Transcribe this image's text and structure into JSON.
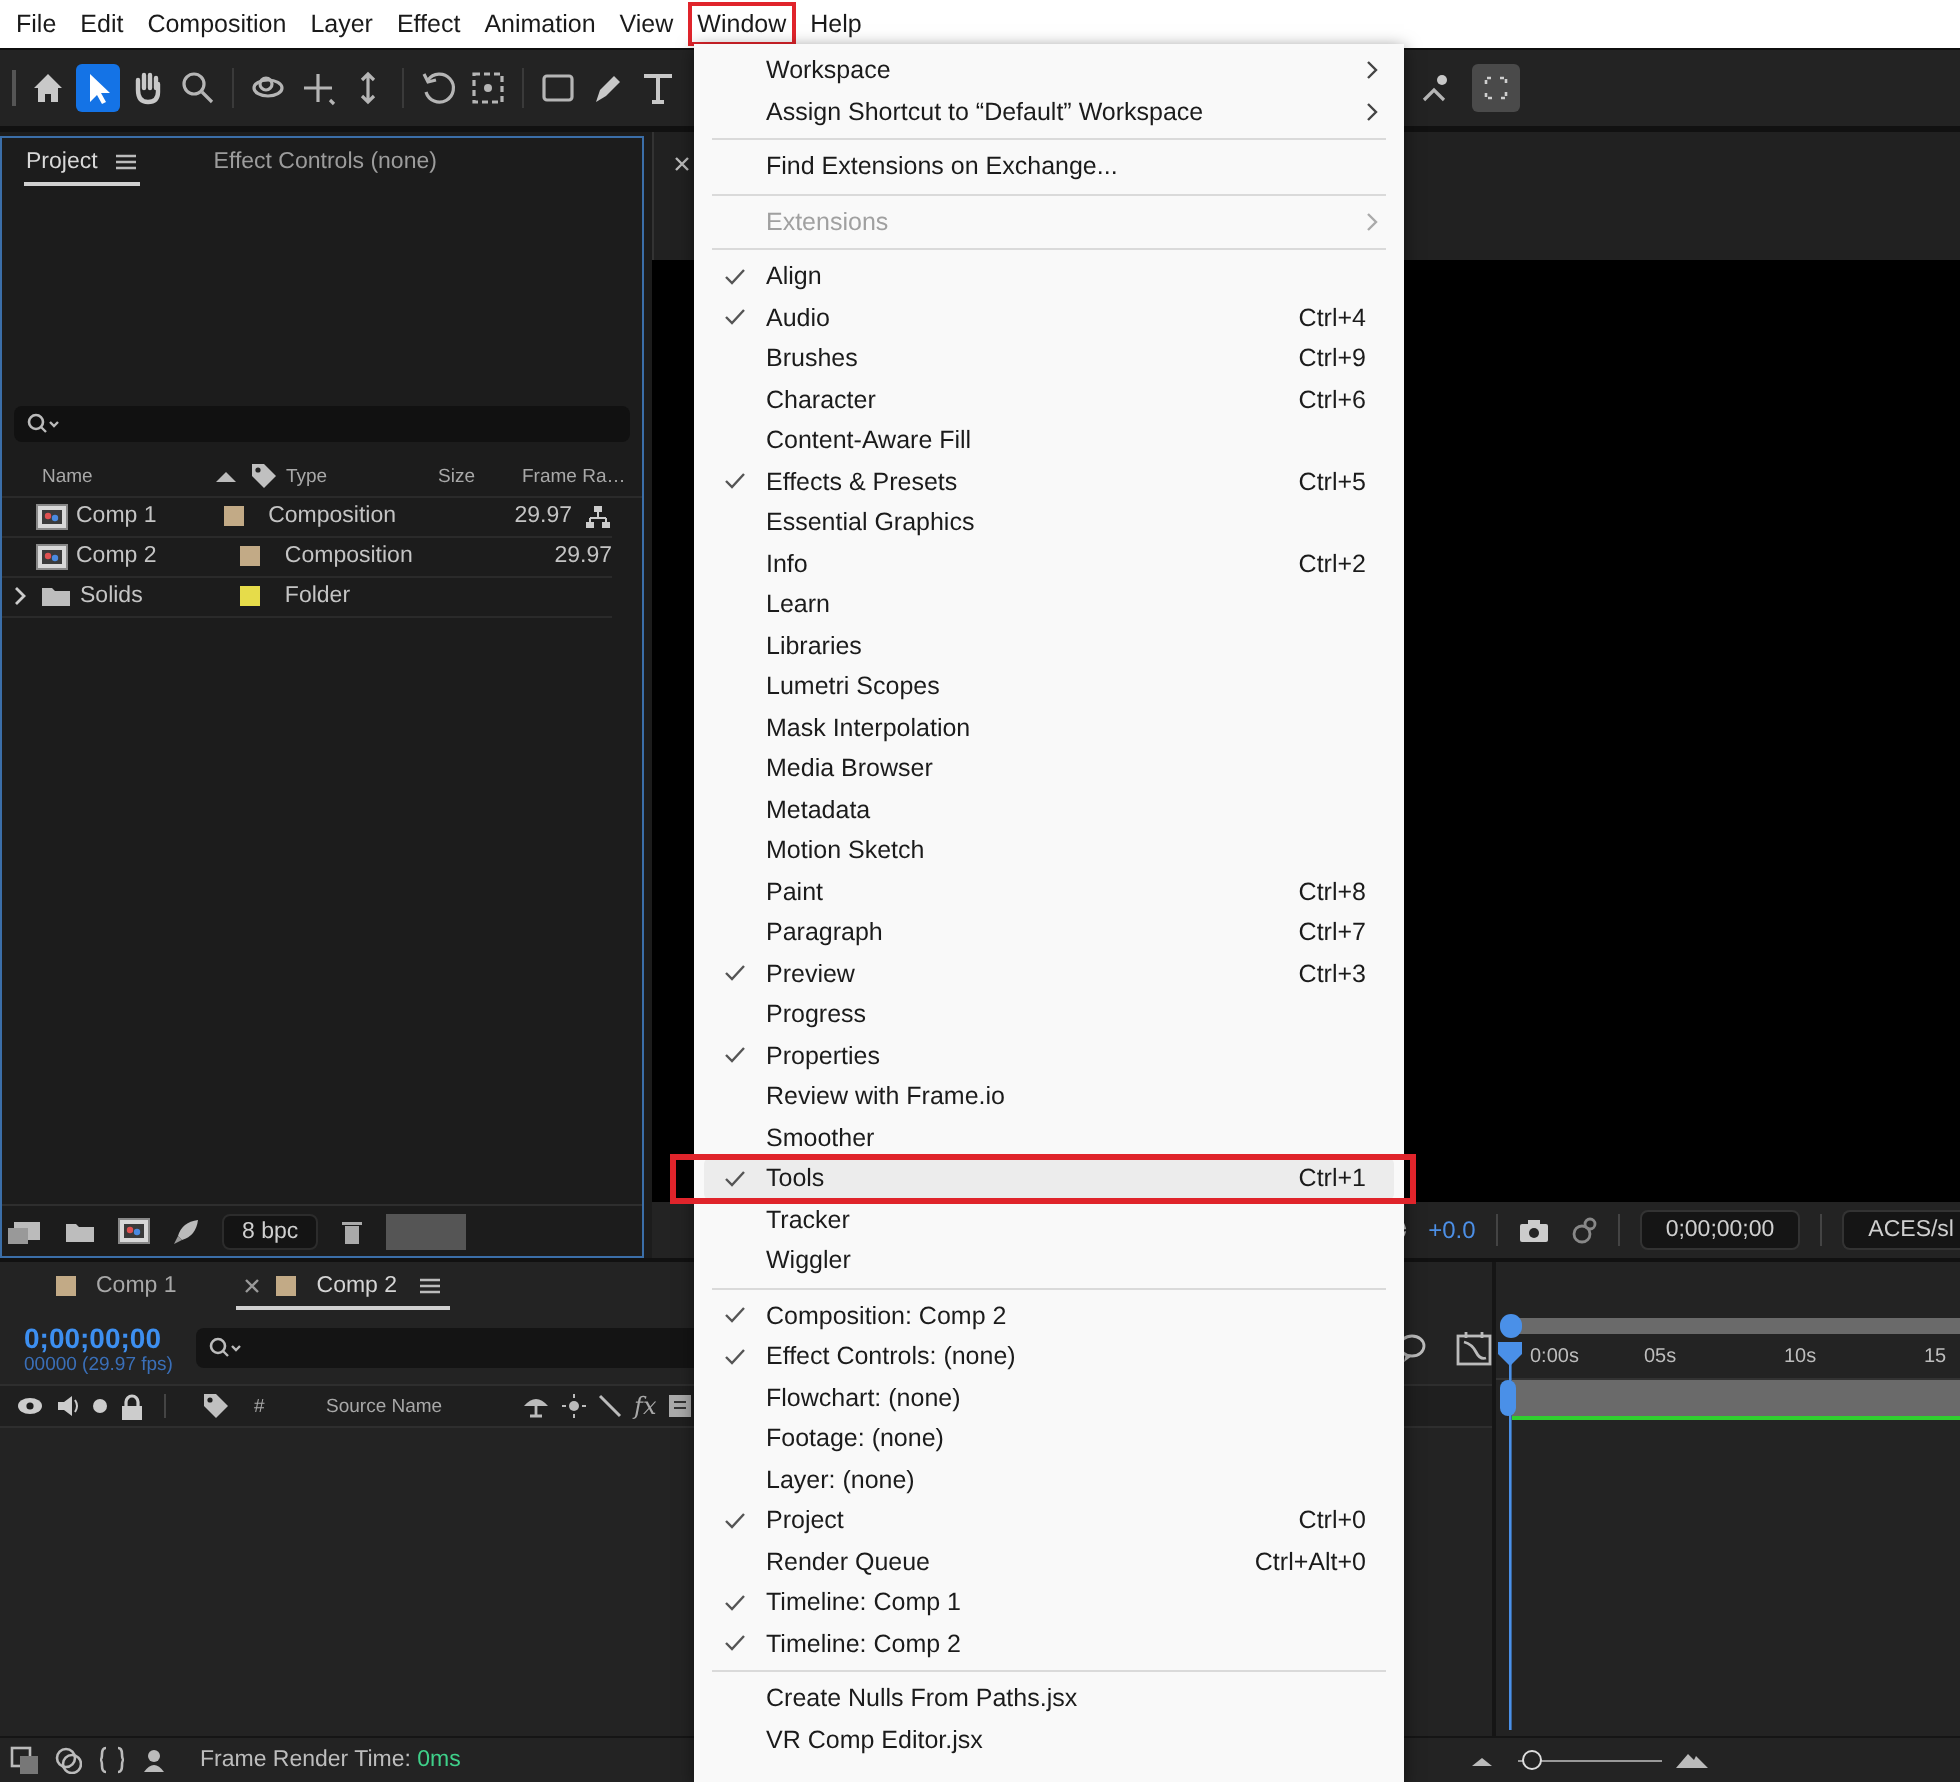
{
  "menubar": [
    {
      "label": "File",
      "selected": false
    },
    {
      "label": "Edit",
      "selected": false
    },
    {
      "label": "Composition",
      "selected": false
    },
    {
      "label": "Layer",
      "selected": false
    },
    {
      "label": "Effect",
      "selected": false
    },
    {
      "label": "Animation",
      "selected": false
    },
    {
      "label": "View",
      "selected": false
    },
    {
      "label": "Window",
      "selected": true
    },
    {
      "label": "Help",
      "selected": false
    }
  ],
  "toolbar": [
    {
      "kind": "home",
      "selected": false
    },
    {
      "kind": "selection",
      "selected": true
    },
    {
      "kind": "hand",
      "selected": false
    },
    {
      "kind": "zoom",
      "selected": false
    },
    {
      "kind": "orbit",
      "selected": false
    },
    {
      "kind": "pan",
      "selected": false
    },
    {
      "kind": "dolly",
      "selected": false
    },
    {
      "kind": "rotate",
      "selected": false
    },
    {
      "kind": "anchor",
      "selected": false
    },
    {
      "kind": "rectangle",
      "selected": false
    },
    {
      "kind": "pen",
      "selected": false
    },
    {
      "kind": "type",
      "selected": false
    }
  ],
  "project_panel": {
    "tabs": [
      {
        "label": "Project",
        "selected": true
      },
      {
        "label": "Effect Controls (none)",
        "selected": false
      }
    ],
    "columns": [
      "Name",
      "Type",
      "Size",
      "Frame Ra…"
    ],
    "rows": [
      {
        "name": "Comp 1",
        "kind": "composition",
        "color": "#c2aa86",
        "type": "Composition",
        "frame_rate": "29.97"
      },
      {
        "name": "Comp 2",
        "kind": "composition",
        "color": "#c2aa86",
        "type": "Composition",
        "frame_rate": "29.97"
      },
      {
        "name": "Solids",
        "kind": "folder",
        "color": "#e6dc4a",
        "type": "Folder"
      }
    ],
    "bit_depth": "8 bpc"
  },
  "viewer": {
    "exposure": "+0.0",
    "timecode": "0;00;00;00",
    "color_space": "ACES/sl"
  },
  "timeline": {
    "tabs": [
      {
        "label": "Comp 1",
        "color": "#c2aa86",
        "selected": false
      },
      {
        "label": "Comp 2",
        "color": "#c2aa86",
        "selected": true
      }
    ],
    "timecode": "0;00;00;00",
    "frame_info": "00000 (29.97 fps)",
    "columns": [
      "#",
      "Source Name",
      "fx"
    ],
    "ruler": [
      "0:00s",
      "05s",
      "10s",
      "15"
    ],
    "zoom": {
      "level": 0.02
    }
  },
  "status_bar": {
    "label": "Frame Render Time:",
    "value": "0ms"
  },
  "window_menu": {
    "sections": [
      [
        {
          "label": "Workspace",
          "kind": "submenu",
          "checked": false,
          "disabled": false,
          "selected": false
        },
        {
          "label": "Assign Shortcut to “Default” Workspace",
          "kind": "submenu",
          "checked": false,
          "disabled": false,
          "selected": false
        }
      ],
      [
        {
          "label": "Find Extensions on Exchange...",
          "kind": "item",
          "checked": false,
          "disabled": false,
          "selected": false
        }
      ],
      [
        {
          "label": "Extensions",
          "kind": "submenu",
          "checked": false,
          "disabled": true,
          "selected": false
        }
      ],
      [
        {
          "label": "Align",
          "kind": "item",
          "checked": true,
          "disabled": false,
          "selected": false
        },
        {
          "label": "Audio",
          "kind": "item",
          "checked": true,
          "disabled": false,
          "selected": false,
          "shortcut": "Ctrl+4"
        },
        {
          "label": "Brushes",
          "kind": "item",
          "checked": false,
          "disabled": false,
          "selected": false,
          "shortcut": "Ctrl+9"
        },
        {
          "label": "Character",
          "kind": "item",
          "checked": false,
          "disabled": false,
          "selected": false,
          "shortcut": "Ctrl+6"
        },
        {
          "label": "Content-Aware Fill",
          "kind": "item",
          "checked": false,
          "disabled": false,
          "selected": false
        },
        {
          "label": "Effects & Presets",
          "kind": "item",
          "checked": true,
          "disabled": false,
          "selected": false,
          "shortcut": "Ctrl+5"
        },
        {
          "label": "Essential Graphics",
          "kind": "item",
          "checked": false,
          "disabled": false,
          "selected": false
        },
        {
          "label": "Info",
          "kind": "item",
          "checked": false,
          "disabled": false,
          "selected": false,
          "shortcut": "Ctrl+2"
        },
        {
          "label": "Learn",
          "kind": "item",
          "checked": false,
          "disabled": false,
          "selected": false
        },
        {
          "label": "Libraries",
          "kind": "item",
          "checked": false,
          "disabled": false,
          "selected": false
        },
        {
          "label": "Lumetri Scopes",
          "kind": "item",
          "checked": false,
          "disabled": false,
          "selected": false
        },
        {
          "label": "Mask Interpolation",
          "kind": "item",
          "checked": false,
          "disabled": false,
          "selected": false
        },
        {
          "label": "Media Browser",
          "kind": "item",
          "checked": false,
          "disabled": false,
          "selected": false
        },
        {
          "label": "Metadata",
          "kind": "item",
          "checked": false,
          "disabled": false,
          "selected": false
        },
        {
          "label": "Motion Sketch",
          "kind": "item",
          "checked": false,
          "disabled": false,
          "selected": false
        },
        {
          "label": "Paint",
          "kind": "item",
          "checked": false,
          "disabled": false,
          "selected": false,
          "shortcut": "Ctrl+8"
        },
        {
          "label": "Paragraph",
          "kind": "item",
          "checked": false,
          "disabled": false,
          "selected": false,
          "shortcut": "Ctrl+7"
        },
        {
          "label": "Preview",
          "kind": "item",
          "checked": true,
          "disabled": false,
          "selected": false,
          "shortcut": "Ctrl+3"
        },
        {
          "label": "Progress",
          "kind": "item",
          "checked": false,
          "disabled": false,
          "selected": false
        },
        {
          "label": "Properties",
          "kind": "item",
          "checked": true,
          "disabled": false,
          "selected": false
        },
        {
          "label": "Review with Frame.io",
          "kind": "item",
          "checked": false,
          "disabled": false,
          "selected": false
        },
        {
          "label": "Smoother",
          "kind": "item",
          "checked": false,
          "disabled": false,
          "selected": false
        },
        {
          "label": "Tools",
          "kind": "item",
          "checked": true,
          "disabled": false,
          "selected": true,
          "shortcut": "Ctrl+1"
        },
        {
          "label": "Tracker",
          "kind": "item",
          "checked": false,
          "disabled": false,
          "selected": false
        },
        {
          "label": "Wiggler",
          "kind": "item",
          "checked": false,
          "disabled": false,
          "selected": false
        }
      ],
      [
        {
          "label": "Composition: Comp 2",
          "kind": "item",
          "checked": true,
          "disabled": false,
          "selected": false
        },
        {
          "label": "Effect Controls: (none)",
          "kind": "item",
          "checked": true,
          "disabled": false,
          "selected": false
        },
        {
          "label": "Flowchart: (none)",
          "kind": "item",
          "checked": false,
          "disabled": false,
          "selected": false
        },
        {
          "label": "Footage: (none)",
          "kind": "item",
          "checked": false,
          "disabled": false,
          "selected": false
        },
        {
          "label": "Layer: (none)",
          "kind": "item",
          "checked": false,
          "disabled": false,
          "selected": false
        },
        {
          "label": "Project",
          "kind": "item",
          "checked": true,
          "disabled": false,
          "selected": false,
          "shortcut": "Ctrl+0"
        },
        {
          "label": "Render Queue",
          "kind": "item",
          "checked": false,
          "disabled": false,
          "selected": false,
          "shortcut": "Ctrl+Alt+0"
        },
        {
          "label": "Timeline: Comp 1",
          "kind": "item",
          "checked": true,
          "disabled": false,
          "selected": false
        },
        {
          "label": "Timeline: Comp 2",
          "kind": "item",
          "checked": true,
          "disabled": false,
          "selected": false
        }
      ],
      [
        {
          "label": "Create Nulls From Paths.jsx",
          "kind": "item",
          "checked": false,
          "disabled": false,
          "selected": false
        },
        {
          "label": "VR Comp Editor.jsx",
          "kind": "item",
          "checked": false,
          "disabled": false,
          "selected": false
        }
      ]
    ]
  }
}
